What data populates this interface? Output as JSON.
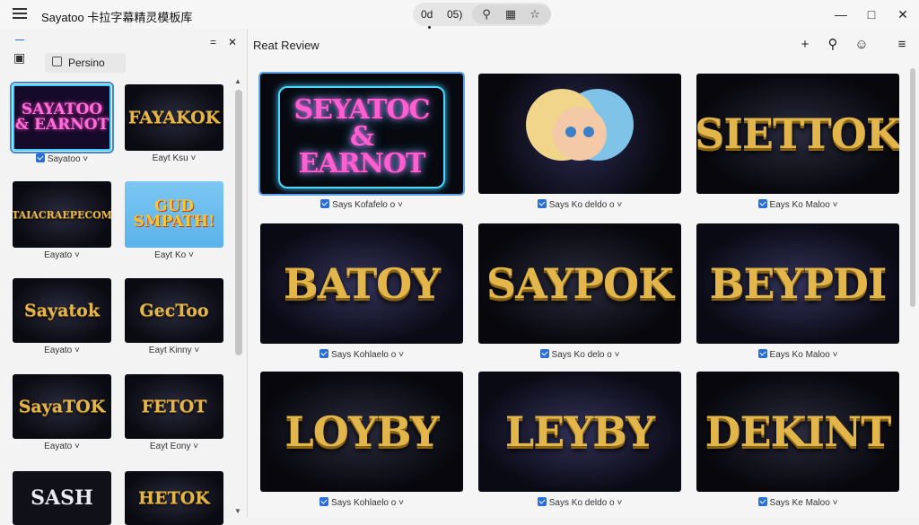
{
  "window": {
    "title": "Sayatoo 卡拉字幕精灵模板库",
    "pill_left": "0d",
    "pill_right": "05)",
    "pill_icons": [
      "search-refine-icon",
      "translate-icon",
      "star-icon"
    ]
  },
  "left_panel": {
    "tab_label": "Persino",
    "thumbnails": [
      {
        "art": "SAYATOO & EARNOT",
        "caption": "Sayatoo",
        "checked": true,
        "style": "neon"
      },
      {
        "art": "FAYAKOK",
        "caption": "Eayt Ksu",
        "checked": false,
        "style": "gold"
      },
      {
        "art": "TAIACRAEPECOM",
        "caption": "Eayato",
        "checked": false,
        "style": "gold"
      },
      {
        "art": "GUD SMPATH!",
        "caption": "Eayt Ko",
        "checked": false,
        "style": "cartoon"
      },
      {
        "art": "Sayatok",
        "caption": "Eayato",
        "checked": false,
        "style": "gold"
      },
      {
        "art": "GecToo",
        "caption": "Eayt Kinny",
        "checked": false,
        "style": "gold"
      },
      {
        "art": "SayaTOK",
        "caption": "Eayato",
        "checked": false,
        "style": "gold"
      },
      {
        "art": "FETOT",
        "caption": "Eayt Eony",
        "checked": false,
        "style": "gold"
      },
      {
        "art": "SASH",
        "caption": "",
        "checked": false,
        "style": "cartoon-face"
      },
      {
        "art": "HETOK",
        "caption": "",
        "checked": false,
        "style": "gold"
      }
    ]
  },
  "right_panel": {
    "title": "Reat Review",
    "cards": [
      {
        "art": "SEYATOC & EARNOT",
        "caption": "Says Kofafelo o",
        "style": "neon"
      },
      {
        "art": "",
        "caption": "Says Ko deldo o",
        "style": "cartoon"
      },
      {
        "art": "SIETTOK",
        "caption": "Eays Ko Maloo",
        "style": "gold"
      },
      {
        "art": "BATOY",
        "caption": "Says Kohlaelo o",
        "style": "gold"
      },
      {
        "art": "SAYPOK",
        "caption": "Says Ko delo o",
        "style": "gold"
      },
      {
        "art": "BEYPDI",
        "caption": "Eays Ko Maloo",
        "style": "gold"
      },
      {
        "art": "LOYBY",
        "caption": "Says Kohlaelo o",
        "style": "gold"
      },
      {
        "art": "LEYBY",
        "caption": "Says Ko deldo o",
        "style": "gold"
      },
      {
        "art": "DEKINT",
        "caption": "Says Ke Maloo",
        "style": "gold"
      }
    ]
  },
  "colors": {
    "accent": "#2a6fd8",
    "gold": "#e2b64a",
    "selection": "#3b86d8"
  }
}
